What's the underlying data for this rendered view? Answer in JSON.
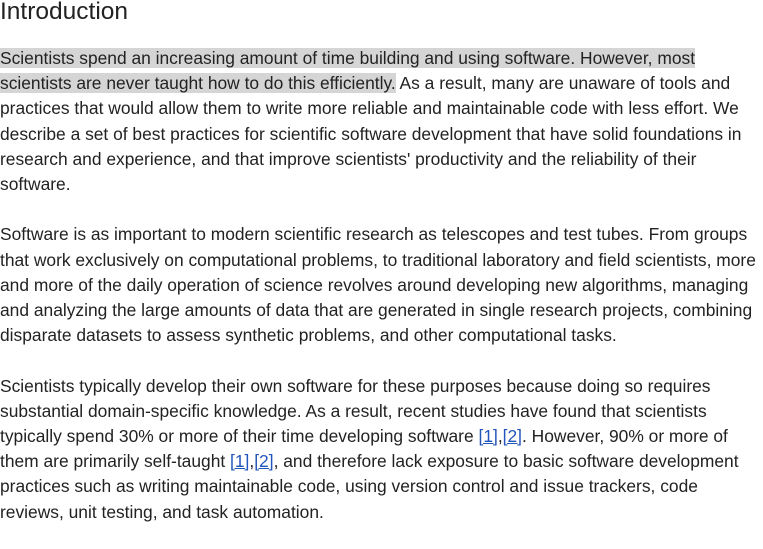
{
  "heading": "Introduction",
  "p1": {
    "highlighted": "Scientists spend an increasing amount of time building and using software. However, most scientists are never taught how to do this efficiently.",
    "rest": " As a result, many are unaware of tools and practices that would allow them to write more reliable and maintainable code with less effort. We describe a set of best practices for scientific software development that have solid foundations in research and experience, and that improve scientists' productivity and the reliability of their software."
  },
  "p2": "Software is as important to modern scientific research as telescopes and test tubes. From groups that work exclusively on computational problems, to traditional laboratory and field scientists, more and more of the daily operation of science revolves around developing new algorithms, managing and analyzing the large amounts of data that are generated in single research projects, combining disparate datasets to assess synthetic problems, and other computational tasks.",
  "p3": {
    "part1": "Scientists typically develop their own software for these purposes because doing so requires substantial domain-specific knowledge. As a result, recent studies have found that scientists typically spend 30% or more of their time developing software ",
    "part2": ". However, 90% or more of them are primarily self-taught ",
    "part3": ", and therefore lack exposure to basic software development practices such as writing maintainable code, using version control and issue trackers, code reviews, unit testing, and task automation.",
    "comma": ","
  },
  "citations": {
    "ref1": "[1]",
    "ref2": "[2]"
  },
  "colors": {
    "text": "#222222",
    "highlight": "#d5d5d5",
    "link": "#2255bb"
  }
}
